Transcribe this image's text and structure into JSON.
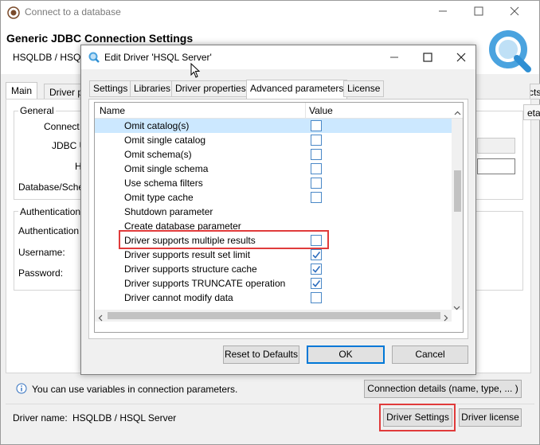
{
  "outer": {
    "title": "Connect to a database",
    "header_title": "Generic JDBC Connection Settings",
    "header_subtitle": "HSQLDB / HSQL",
    "tabs": [
      "Main",
      "Driver p"
    ],
    "general_label": "General",
    "labels": [
      "Connect",
      "JDBC U",
      "H",
      "Database/Sche"
    ],
    "auth_group": "Authentication",
    "auth_label": "Authentication",
    "username_label": "Username:",
    "password_label": "Password:",
    "right_tab_fragment": "cts",
    "right_tab_fragment2": "eta",
    "info_text": "You can use variables in connection parameters.",
    "connection_details_button": "Connection details (name, type, ... )",
    "driver_name_label": "Driver name:",
    "driver_name_value": "HSQLDB / HSQL Server",
    "driver_settings_button": "Driver Settings",
    "driver_license_button": "Driver license"
  },
  "dialog": {
    "title": "Edit Driver 'HSQL Server'",
    "tabs": [
      "Settings",
      "Libraries",
      "Driver properties",
      "Advanced parameters",
      "License"
    ],
    "active_tab": "Advanced parameters",
    "columns": {
      "name": "Name",
      "value": "Value"
    },
    "rows": [
      {
        "name": "Omit catalog(s)",
        "checkbox": true,
        "checked": false,
        "selected": true
      },
      {
        "name": "Omit single catalog",
        "checkbox": true,
        "checked": false
      },
      {
        "name": "Omit schema(s)",
        "checkbox": true,
        "checked": false
      },
      {
        "name": "Omit single schema",
        "checkbox": true,
        "checked": false
      },
      {
        "name": "Use schema filters",
        "checkbox": true,
        "checked": false
      },
      {
        "name": "Omit type cache",
        "checkbox": true,
        "checked": false
      },
      {
        "name": "Shutdown parameter",
        "checkbox": false
      },
      {
        "name": "Create database parameter",
        "checkbox": false
      },
      {
        "name": "Driver supports multiple results",
        "checkbox": true,
        "checked": false,
        "highlighted": true
      },
      {
        "name": "Driver supports result set limit",
        "checkbox": true,
        "checked": true
      },
      {
        "name": "Driver supports structure cache",
        "checkbox": true,
        "checked": true
      },
      {
        "name": "Driver supports TRUNCATE operation",
        "checkbox": true,
        "checked": true
      },
      {
        "name": "Driver cannot modify data",
        "checkbox": true,
        "checked": false
      }
    ],
    "buttons": {
      "reset": "Reset to Defaults",
      "ok": "OK",
      "cancel": "Cancel"
    }
  },
  "colors": {
    "accent": "#0078d7",
    "highlight": "#e03b3b",
    "selected_row": "#cce8ff",
    "checkbox_border": "#4a88c7"
  }
}
